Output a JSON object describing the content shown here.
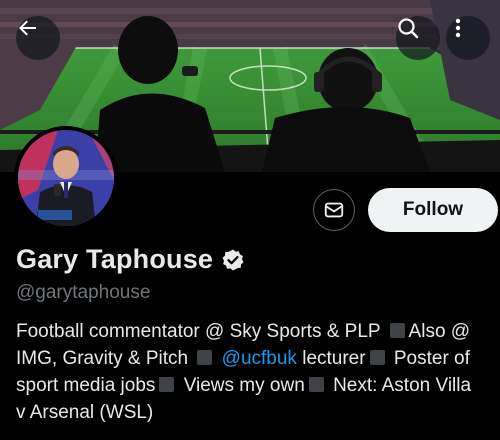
{
  "header": {
    "back_icon": "arrow-left-icon",
    "search_icon": "search-icon",
    "more_icon": "more-vertical-icon"
  },
  "banner": {
    "description_visible": false
  },
  "profile": {
    "display_name": "Gary Taphouse",
    "handle": "@garytaphouse",
    "verified": true,
    "verified_icon": "verified-badge-icon",
    "follow_label": "Follow",
    "message_icon": "envelope-icon"
  },
  "bio": {
    "line1": {
      "text": "Football commentator @ Sky Sports & PLP",
      "after_sq": "Also @"
    },
    "line2": {
      "text": "IMG, Gravity & Pitch",
      "mention": "@ucfbuk",
      "text_b": "lecturer",
      "after_sq": "Poster of"
    },
    "line3": {
      "text": "sport media jobs",
      "text_b": "Views my own",
      "after_sq": "Next: Aston Villa"
    },
    "line4": {
      "text": "v Arsenal (WSL)"
    }
  },
  "colors": {
    "background": "#000000",
    "text": "#e7e9ea",
    "muted": "#71767b",
    "link": "#1d9bf0",
    "follow_bg": "#eff3f4"
  }
}
